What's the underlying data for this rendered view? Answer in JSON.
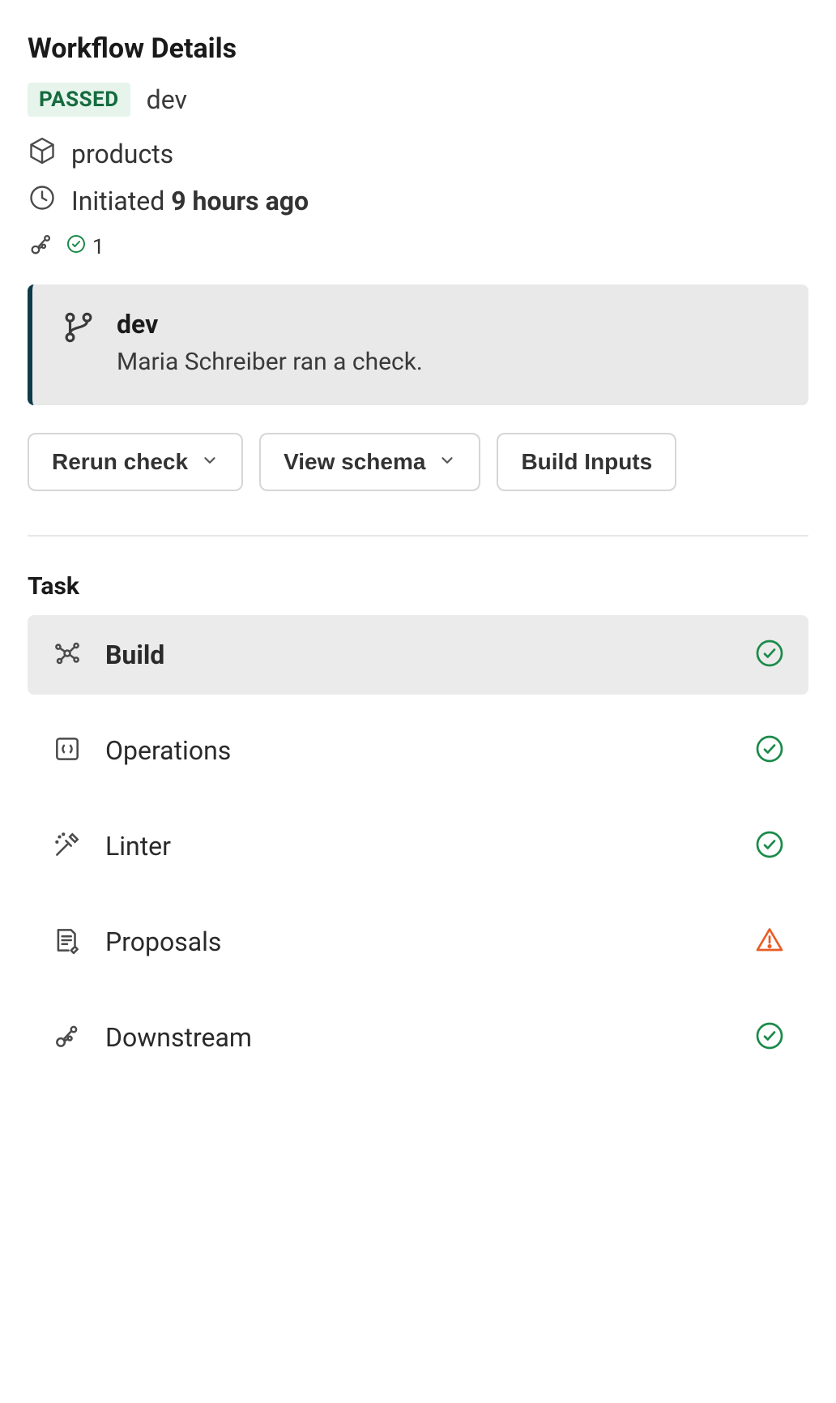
{
  "header": {
    "title": "Workflow Details",
    "status": "PASSED",
    "branch": "dev"
  },
  "meta": {
    "product": "products",
    "initiated_label": "Initiated",
    "initiated_time": "9 hours ago",
    "checks_count": "1"
  },
  "event": {
    "branch": "dev",
    "description": "Maria Schreiber ran a check."
  },
  "actions": {
    "rerun": "Rerun check",
    "view_schema": "View schema",
    "build_inputs": "Build Inputs"
  },
  "tasks": {
    "title": "Task",
    "items": [
      {
        "label": "Build",
        "status": "success",
        "active": true
      },
      {
        "label": "Operations",
        "status": "success",
        "active": false
      },
      {
        "label": "Linter",
        "status": "success",
        "active": false
      },
      {
        "label": "Proposals",
        "status": "warning",
        "active": false
      },
      {
        "label": "Downstream",
        "status": "success",
        "active": false
      }
    ]
  },
  "colors": {
    "success": "#1b8a4a",
    "warning": "#e85d27"
  }
}
